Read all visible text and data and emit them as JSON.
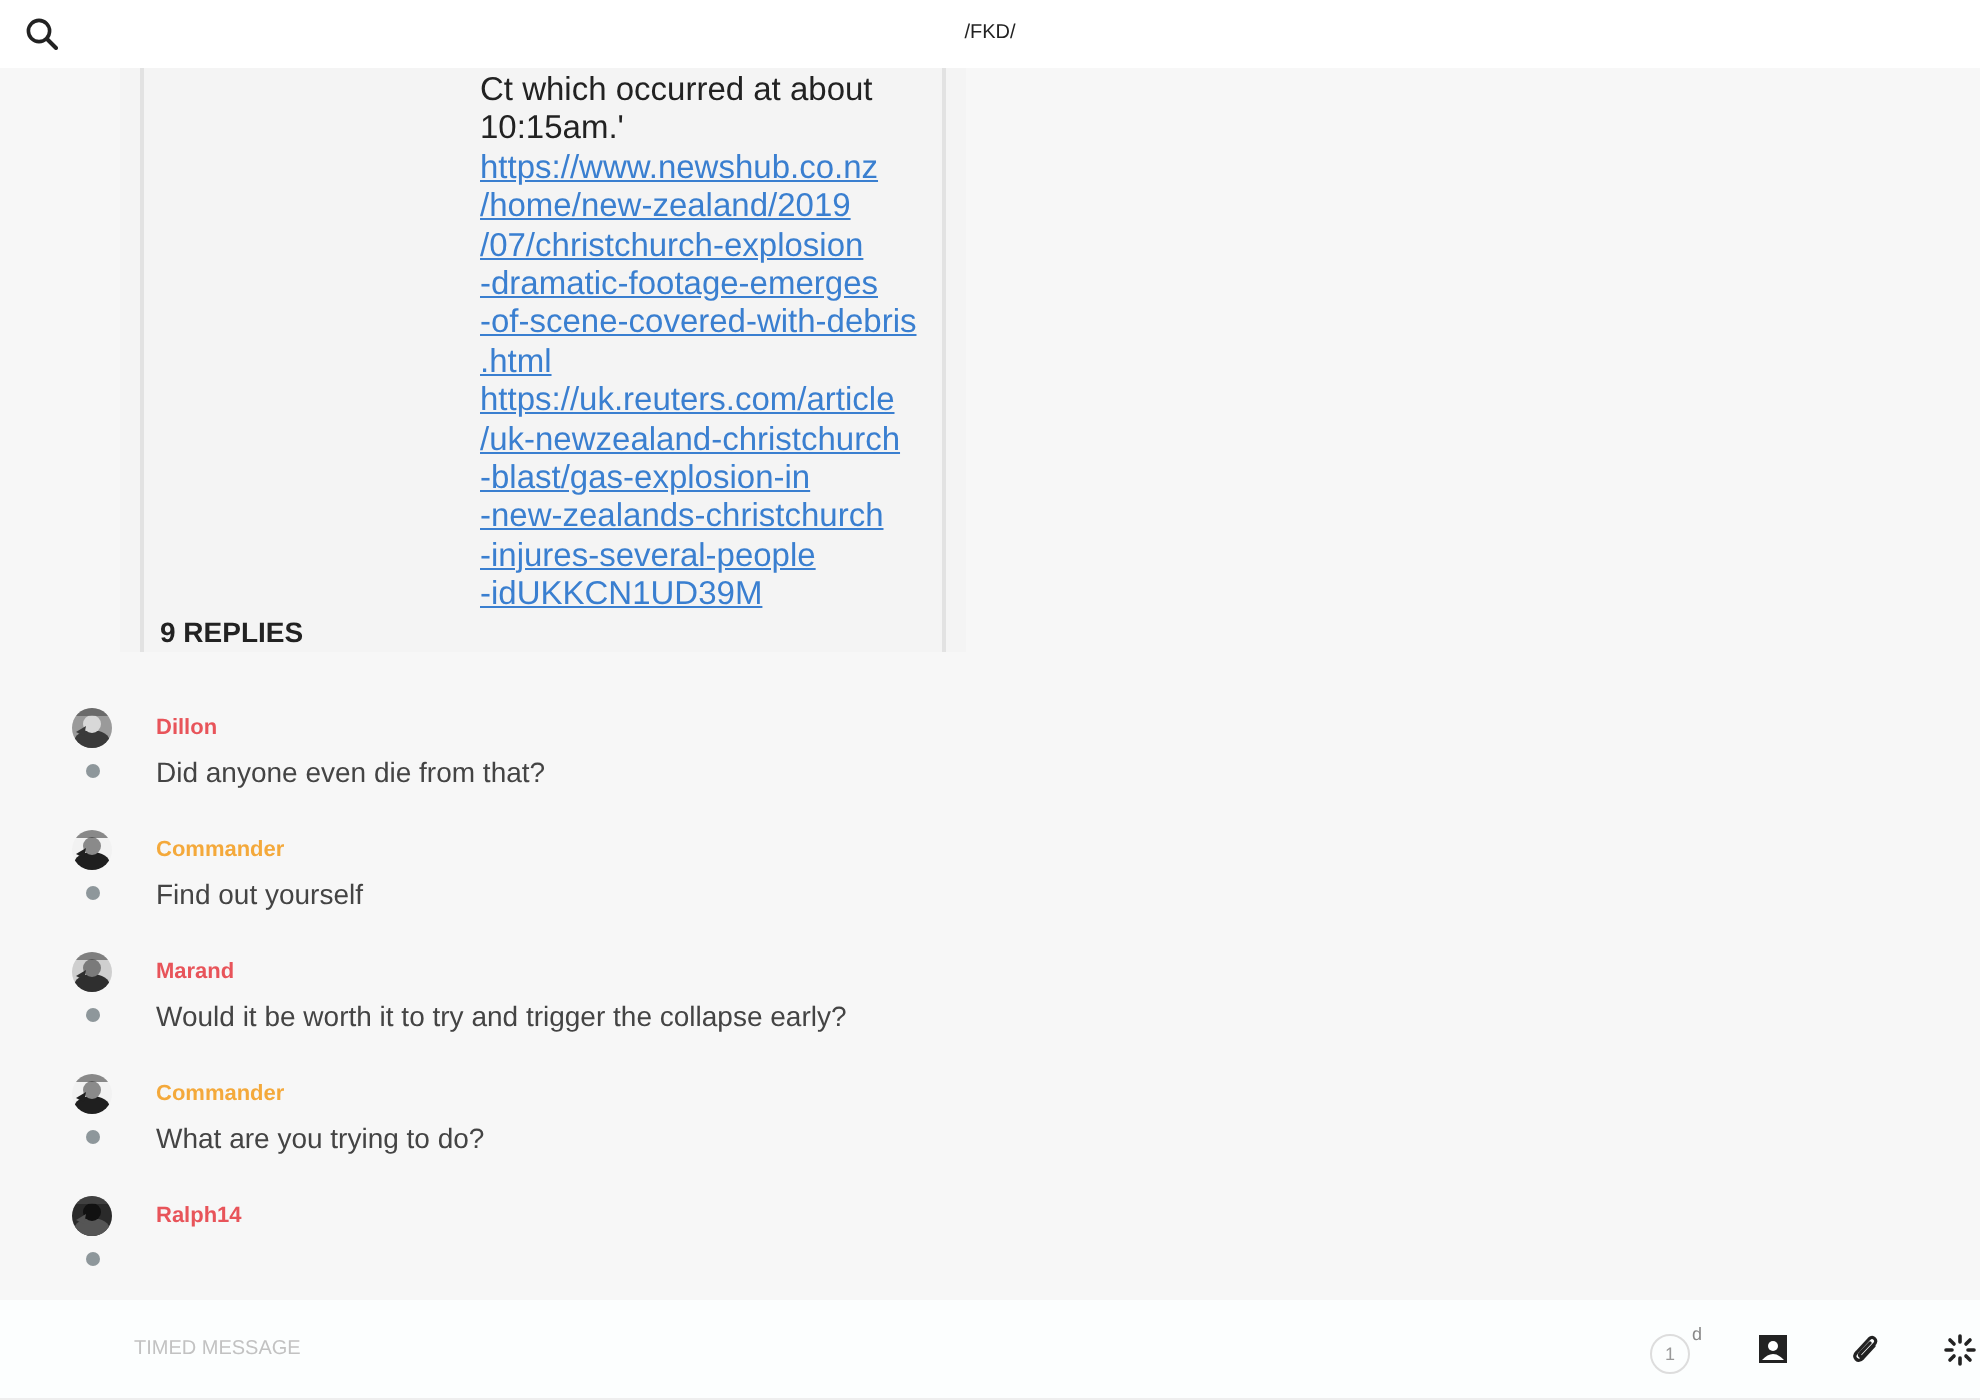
{
  "header": {
    "title": "/FKD/"
  },
  "shared_image": {
    "lines": [
      {
        "text": "Ct which occurred at about",
        "link": false
      },
      {
        "text": "10:15am.'",
        "link": false
      },
      {
        "text": "https://www.newshub.co.nz",
        "link": true
      },
      {
        "text": "/home/new-zealand/2019",
        "link": true
      },
      {
        "text": "/07/christchurch-explosion",
        "link": true
      },
      {
        "text": "-dramatic-footage-emerges",
        "link": true
      },
      {
        "text": "-of-scene-covered-with-debris",
        "link": true
      },
      {
        "text": ".html",
        "link": true
      },
      {
        "text": "https://uk.reuters.com/article",
        "link": true
      },
      {
        "text": "/uk-newzealand-christchurch",
        "link": true
      },
      {
        "text": "-blast/gas-explosion-in",
        "link": true
      },
      {
        "text": "-new-zealands-christchurch",
        "link": true
      },
      {
        "text": "-injures-several-people",
        "link": true
      },
      {
        "text": "-idUKKCN1UD39M",
        "link": true
      }
    ],
    "replies": "9 REPLIES"
  },
  "messages": [
    {
      "author": "Dillon",
      "color": "#e8545a",
      "text": "Did anyone even die from that?"
    },
    {
      "author": "Commander",
      "color": "#f4a93b",
      "text": "Find out yourself"
    },
    {
      "author": "Marand",
      "color": "#e8545a",
      "text": "Would it be worth it to try and trigger the collapse early?"
    },
    {
      "author": "Commander",
      "color": "#f4a93b",
      "text": "What are you trying to do?"
    },
    {
      "author": "Ralph14",
      "color": "#e8545a"
    }
  ],
  "composer": {
    "placeholder": "TIMED MESSAGE",
    "timer_value": "1",
    "timer_unit": "d"
  }
}
